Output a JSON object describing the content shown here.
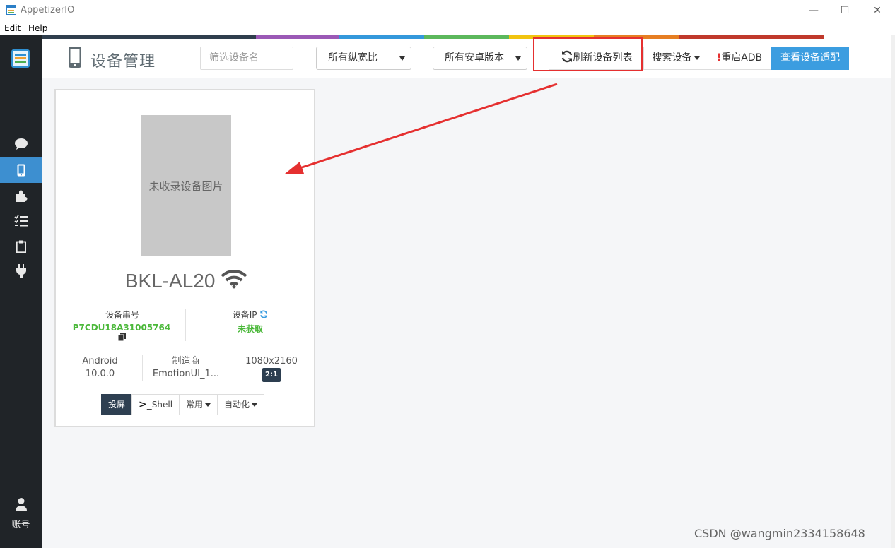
{
  "window": {
    "title": "AppetizerIO",
    "minimize": "—",
    "maximize": "☐",
    "close": "✕"
  },
  "menu": {
    "items": [
      "Edit",
      "Help"
    ]
  },
  "sidebar": {
    "account_label": "账号"
  },
  "toolbar": {
    "page_title": "设备管理",
    "filter_placeholder": "筛选设备名",
    "aspect_select": "所有纵宽比",
    "android_select": "所有安卓版本",
    "refresh_label": "刷新设备列表",
    "search_label": "搜索设备",
    "restart_adb_label": "重启ADB",
    "restart_adb_mark": "!",
    "view_adapt_label": "查看设备适配"
  },
  "device": {
    "no_image_text": "未收录设备图片",
    "name": "BKL-AL20",
    "serial_label": "设备串号",
    "serial_value": "P7CDU18A31005764",
    "ip_label": "设备IP",
    "ip_value": "未获取",
    "os_name": "Android",
    "os_version": "10.0.0",
    "maker_label": "制造商",
    "maker_value": "EmotionUI_1...",
    "resolution": "1080x2160",
    "ratio": "2:1",
    "actions": {
      "cast": "投屏",
      "shell": "Shell",
      "common": "常用",
      "automation": "自动化"
    }
  },
  "colors": {
    "sidebar_bg": "#202428",
    "active_blue": "#3d8fd0",
    "primary_btn": "#3b9de0",
    "serial_green": "#4bb83a",
    "annotation_red": "#e53030"
  },
  "watermark": "CSDN @wangmin2334158648"
}
